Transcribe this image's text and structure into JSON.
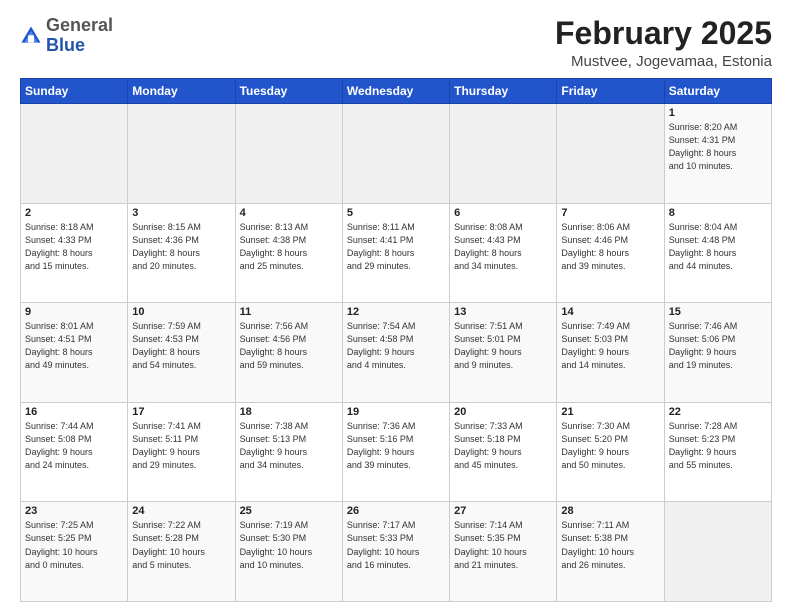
{
  "header": {
    "logo": {
      "general": "General",
      "blue": "Blue"
    },
    "title": "February 2025",
    "location": "Mustvee, Jogevamaa, Estonia"
  },
  "days_of_week": [
    "Sunday",
    "Monday",
    "Tuesday",
    "Wednesday",
    "Thursday",
    "Friday",
    "Saturday"
  ],
  "weeks": [
    [
      {
        "day": "",
        "info": ""
      },
      {
        "day": "",
        "info": ""
      },
      {
        "day": "",
        "info": ""
      },
      {
        "day": "",
        "info": ""
      },
      {
        "day": "",
        "info": ""
      },
      {
        "day": "",
        "info": ""
      },
      {
        "day": "1",
        "info": "Sunrise: 8:20 AM\nSunset: 4:31 PM\nDaylight: 8 hours\nand 10 minutes."
      }
    ],
    [
      {
        "day": "2",
        "info": "Sunrise: 8:18 AM\nSunset: 4:33 PM\nDaylight: 8 hours\nand 15 minutes."
      },
      {
        "day": "3",
        "info": "Sunrise: 8:15 AM\nSunset: 4:36 PM\nDaylight: 8 hours\nand 20 minutes."
      },
      {
        "day": "4",
        "info": "Sunrise: 8:13 AM\nSunset: 4:38 PM\nDaylight: 8 hours\nand 25 minutes."
      },
      {
        "day": "5",
        "info": "Sunrise: 8:11 AM\nSunset: 4:41 PM\nDaylight: 8 hours\nand 29 minutes."
      },
      {
        "day": "6",
        "info": "Sunrise: 8:08 AM\nSunset: 4:43 PM\nDaylight: 8 hours\nand 34 minutes."
      },
      {
        "day": "7",
        "info": "Sunrise: 8:06 AM\nSunset: 4:46 PM\nDaylight: 8 hours\nand 39 minutes."
      },
      {
        "day": "8",
        "info": "Sunrise: 8:04 AM\nSunset: 4:48 PM\nDaylight: 8 hours\nand 44 minutes."
      }
    ],
    [
      {
        "day": "9",
        "info": "Sunrise: 8:01 AM\nSunset: 4:51 PM\nDaylight: 8 hours\nand 49 minutes."
      },
      {
        "day": "10",
        "info": "Sunrise: 7:59 AM\nSunset: 4:53 PM\nDaylight: 8 hours\nand 54 minutes."
      },
      {
        "day": "11",
        "info": "Sunrise: 7:56 AM\nSunset: 4:56 PM\nDaylight: 8 hours\nand 59 minutes."
      },
      {
        "day": "12",
        "info": "Sunrise: 7:54 AM\nSunset: 4:58 PM\nDaylight: 9 hours\nand 4 minutes."
      },
      {
        "day": "13",
        "info": "Sunrise: 7:51 AM\nSunset: 5:01 PM\nDaylight: 9 hours\nand 9 minutes."
      },
      {
        "day": "14",
        "info": "Sunrise: 7:49 AM\nSunset: 5:03 PM\nDaylight: 9 hours\nand 14 minutes."
      },
      {
        "day": "15",
        "info": "Sunrise: 7:46 AM\nSunset: 5:06 PM\nDaylight: 9 hours\nand 19 minutes."
      }
    ],
    [
      {
        "day": "16",
        "info": "Sunrise: 7:44 AM\nSunset: 5:08 PM\nDaylight: 9 hours\nand 24 minutes."
      },
      {
        "day": "17",
        "info": "Sunrise: 7:41 AM\nSunset: 5:11 PM\nDaylight: 9 hours\nand 29 minutes."
      },
      {
        "day": "18",
        "info": "Sunrise: 7:38 AM\nSunset: 5:13 PM\nDaylight: 9 hours\nand 34 minutes."
      },
      {
        "day": "19",
        "info": "Sunrise: 7:36 AM\nSunset: 5:16 PM\nDaylight: 9 hours\nand 39 minutes."
      },
      {
        "day": "20",
        "info": "Sunrise: 7:33 AM\nSunset: 5:18 PM\nDaylight: 9 hours\nand 45 minutes."
      },
      {
        "day": "21",
        "info": "Sunrise: 7:30 AM\nSunset: 5:20 PM\nDaylight: 9 hours\nand 50 minutes."
      },
      {
        "day": "22",
        "info": "Sunrise: 7:28 AM\nSunset: 5:23 PM\nDaylight: 9 hours\nand 55 minutes."
      }
    ],
    [
      {
        "day": "23",
        "info": "Sunrise: 7:25 AM\nSunset: 5:25 PM\nDaylight: 10 hours\nand 0 minutes."
      },
      {
        "day": "24",
        "info": "Sunrise: 7:22 AM\nSunset: 5:28 PM\nDaylight: 10 hours\nand 5 minutes."
      },
      {
        "day": "25",
        "info": "Sunrise: 7:19 AM\nSunset: 5:30 PM\nDaylight: 10 hours\nand 10 minutes."
      },
      {
        "day": "26",
        "info": "Sunrise: 7:17 AM\nSunset: 5:33 PM\nDaylight: 10 hours\nand 16 minutes."
      },
      {
        "day": "27",
        "info": "Sunrise: 7:14 AM\nSunset: 5:35 PM\nDaylight: 10 hours\nand 21 minutes."
      },
      {
        "day": "28",
        "info": "Sunrise: 7:11 AM\nSunset: 5:38 PM\nDaylight: 10 hours\nand 26 minutes."
      },
      {
        "day": "",
        "info": ""
      }
    ]
  ]
}
